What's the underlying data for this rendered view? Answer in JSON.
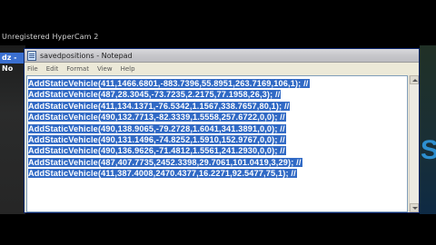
{
  "watermark": "Unregistered HyperCam 2",
  "taskbar_fragment": "dz - No",
  "window": {
    "title": "savedpositions - Notepad",
    "menu": [
      "File",
      "Edit",
      "Format",
      "View",
      "Help"
    ]
  },
  "editor": {
    "lines": [
      "AddStaticVehicle(411,1466.6801,-883.7396,55.8951,263.7169,106,1); //",
      "AddStaticVehicle(487,28.3045,-73.7235,2.2175,77.1958,26,3); //",
      "AddStaticVehicle(411,134.1371,-76.5342,1.1567,338.7657,80,1); //",
      "AddStaticVehicle(490,132.7713,-82.3339,1.5558,257.6722,0,0); //",
      "AddStaticVehicle(490,138.9065,-79.2728,1.6041,341.3891,0,0); //",
      "AddStaticVehicle(490,131.1496,-74.8252,1.5910,152.9767,0,0); //",
      "AddStaticVehicle(490,136.9626,-71.4812,1.5561,241.2930,0,0); //",
      "AddStaticVehicle(487,407.7735,2452.3398,29.7061,101.0419,3,29); //",
      "AddStaticVehicle(411,387.4008,2470.4377,16.2271,92.5477,75,1); //"
    ],
    "selection_color": "#316ac5"
  },
  "background_letter": "S",
  "icons": {
    "app": "notepad-icon"
  }
}
